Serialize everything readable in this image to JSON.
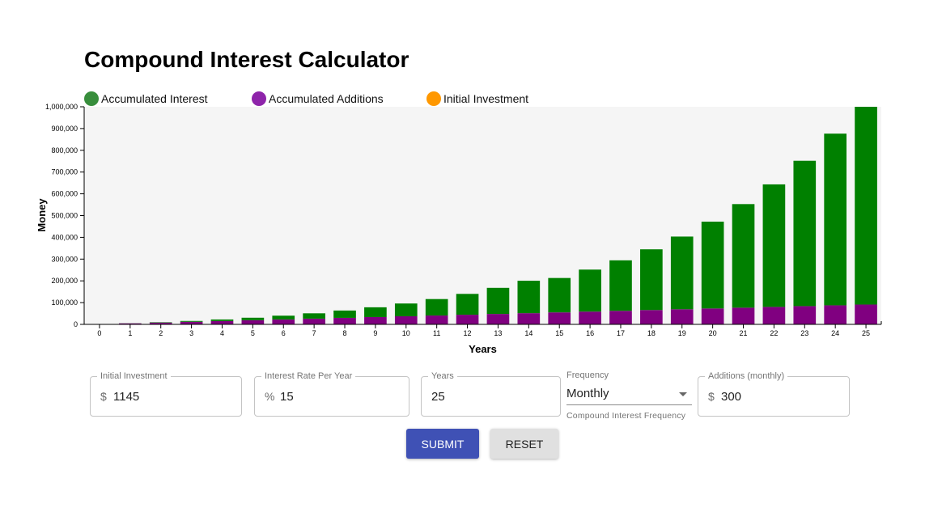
{
  "page": {
    "title": "Compound Interest Calculator"
  },
  "legend": [
    {
      "label": "Accumulated Interest",
      "color": "#388e3c"
    },
    {
      "label": "Accumulated Additions",
      "color": "#8e24aa"
    },
    {
      "label": "Initial Investment",
      "color": "#ff9800"
    }
  ],
  "form": {
    "initial_investment": {
      "label": "Initial Investment",
      "prefix": "$",
      "value": "1145"
    },
    "interest_rate": {
      "label": "Interest Rate Per Year",
      "prefix": "%",
      "value": "15"
    },
    "years": {
      "label": "Years",
      "value": "25"
    },
    "frequency": {
      "label": "Frequency",
      "value": "Monthly",
      "helper": "Compound Interest Frequency"
    },
    "additions": {
      "label": "Additions (monthly)",
      "prefix": "$",
      "value": "300"
    }
  },
  "buttons": {
    "submit": "SUBMIT",
    "reset": "RESET"
  },
  "chart_data": {
    "type": "bar",
    "stacked": true,
    "xlabel": "Years",
    "ylabel": "Money",
    "ylim": [
      0,
      1000000
    ],
    "yticks": [
      0,
      100000,
      200000,
      300000,
      400000,
      500000,
      600000,
      700000,
      800000,
      900000,
      1000000
    ],
    "ytick_labels": [
      "0",
      "100,000",
      "200,000",
      "300,000",
      "400,000",
      "500,000",
      "600,000",
      "700,000",
      "800,000",
      "900,000",
      "1,000,000"
    ],
    "categories": [
      "0",
      "1",
      "2",
      "3",
      "4",
      "5",
      "6",
      "7",
      "8",
      "9",
      "10",
      "11",
      "12",
      "13",
      "14",
      "15",
      "16",
      "17",
      "18",
      "19",
      "20",
      "21",
      "22",
      "23",
      "24",
      "25"
    ],
    "series": [
      {
        "name": "Initial Investment",
        "color": "#ff9800",
        "values": [
          1145,
          1145,
          1145,
          1145,
          1145,
          1145,
          1145,
          1145,
          1145,
          1145,
          1145,
          1145,
          1145,
          1145,
          1145,
          1145,
          1145,
          1145,
          1145,
          1145,
          1145,
          1145,
          1145,
          1145,
          1145,
          1145
        ]
      },
      {
        "name": "Accumulated Additions",
        "color": "#800080",
        "values": [
          0,
          3600,
          7200,
          10800,
          14400,
          18000,
          21600,
          25200,
          28800,
          32400,
          36000,
          39600,
          43200,
          46800,
          50400,
          54000,
          57600,
          61200,
          64800,
          68400,
          72000,
          75600,
          79200,
          82800,
          86400,
          90000
        ]
      },
      {
        "name": "Accumulated Interest",
        "color": "#008000",
        "values": [
          0,
          480,
          1700,
          3800,
          7000,
          11400,
          17200,
          24500,
          33700,
          45000,
          58800,
          75600,
          95800,
          120000,
          149000,
          158000,
          193000,
          232000,
          279000,
          334000,
          399000,
          476000,
          563000,
          668000,
          789000,
          930000
        ]
      }
    ]
  }
}
